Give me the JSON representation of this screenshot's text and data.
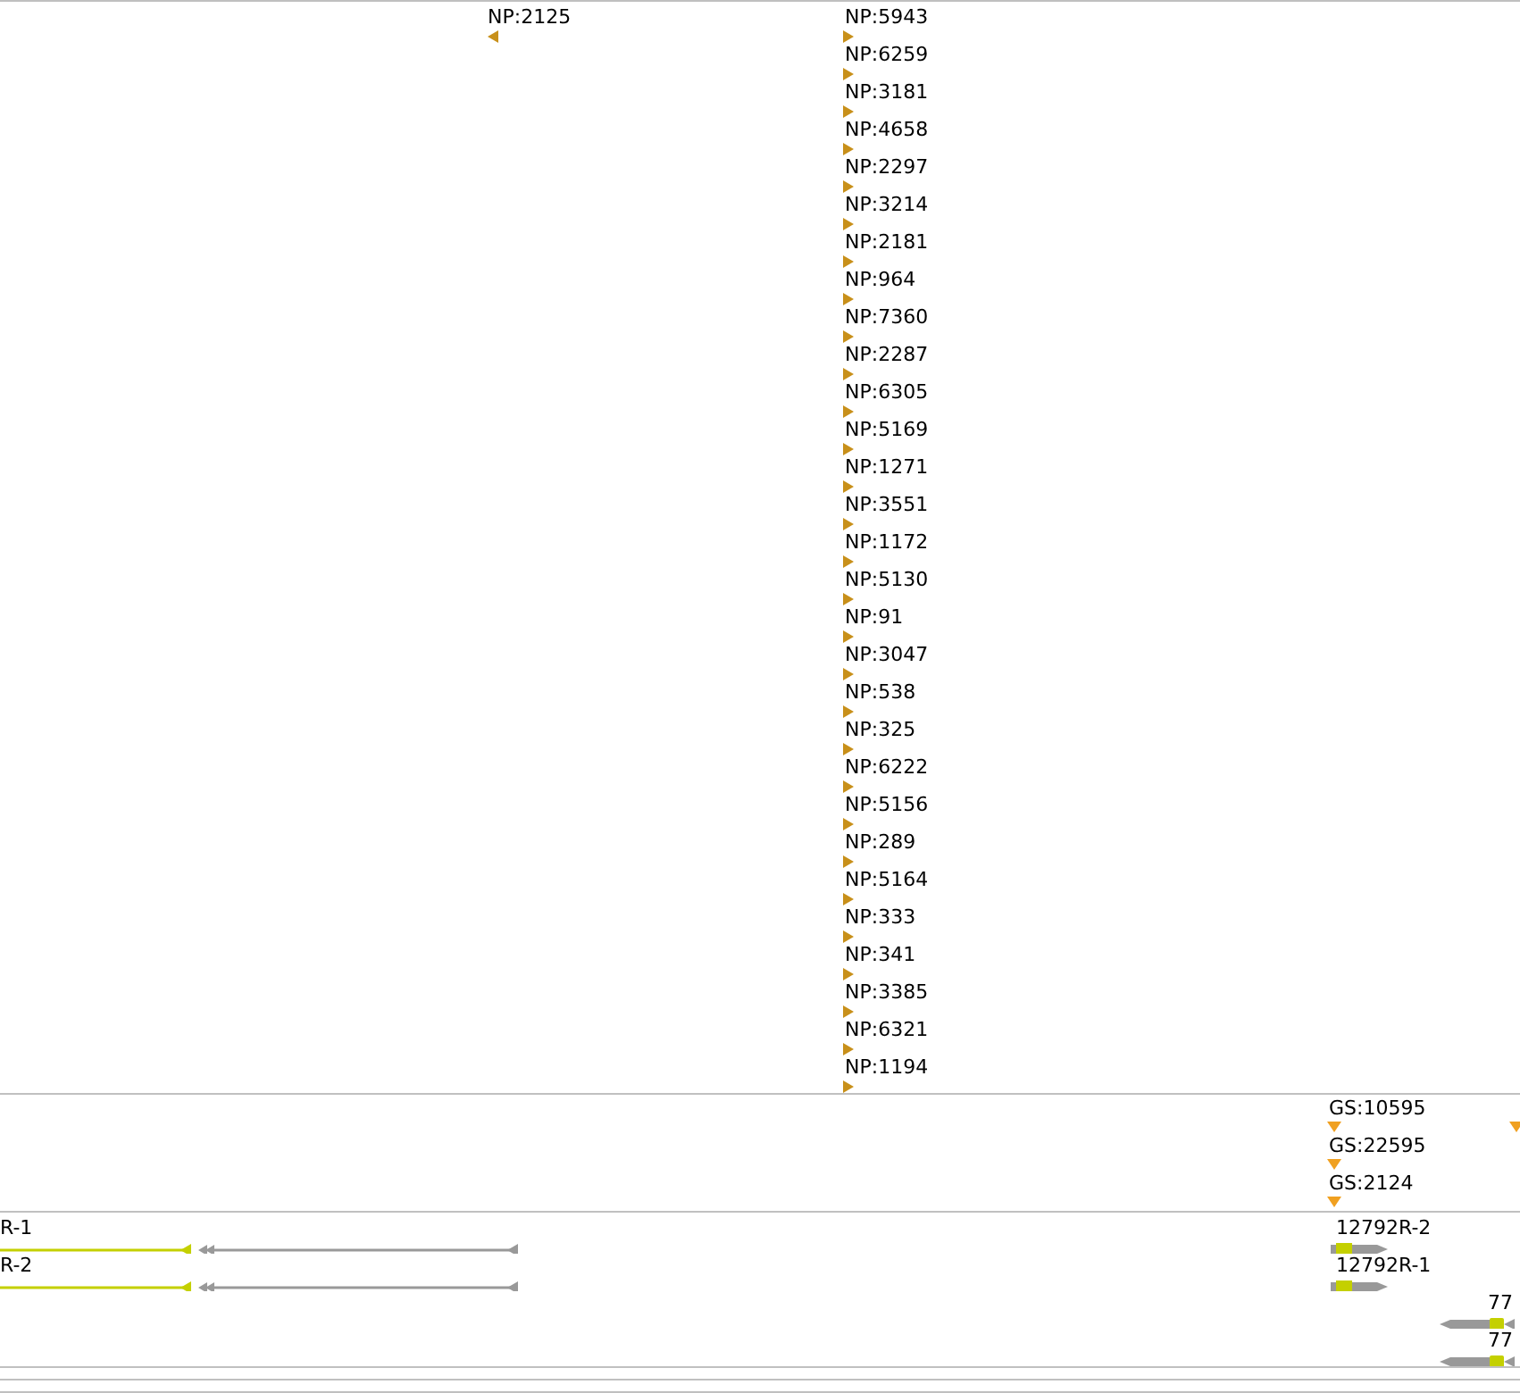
{
  "tracks": [
    {
      "kind": "stranded",
      "stacks": [
        {
          "features": [
            {
              "label": "NP:2125",
              "reverse": true
            }
          ]
        },
        {
          "features": [
            {
              "label": "NP:5943",
              "reverse": false
            },
            {
              "label": "NP:6259",
              "reverse": false
            },
            {
              "label": "NP:3181",
              "reverse": false
            },
            {
              "label": "NP:4658",
              "reverse": false
            },
            {
              "label": "NP:2297",
              "reverse": false
            },
            {
              "label": "NP:3214",
              "reverse": false
            },
            {
              "label": "NP:2181",
              "reverse": false
            },
            {
              "label": "NP:964",
              "reverse": false
            },
            {
              "label": "NP:7360",
              "reverse": false
            },
            {
              "label": "NP:2287",
              "reverse": false
            },
            {
              "label": "NP:6305",
              "reverse": false
            },
            {
              "label": "NP:5169",
              "reverse": false
            },
            {
              "label": "NP:1271",
              "reverse": false
            },
            {
              "label": "NP:3551",
              "reverse": false
            },
            {
              "label": "NP:1172",
              "reverse": false
            },
            {
              "label": "NP:5130",
              "reverse": false
            },
            {
              "label": "NP:91",
              "reverse": false
            },
            {
              "label": "NP:3047",
              "reverse": false
            },
            {
              "label": "NP:538",
              "reverse": false
            },
            {
              "label": "NP:325",
              "reverse": false
            },
            {
              "label": "NP:6222",
              "reverse": false
            },
            {
              "label": "NP:5156",
              "reverse": false
            },
            {
              "label": "NP:289",
              "reverse": false
            },
            {
              "label": "NP:5164",
              "reverse": false
            },
            {
              "label": "NP:333",
              "reverse": false
            },
            {
              "label": "NP:341",
              "reverse": false
            },
            {
              "label": "NP:3385",
              "reverse": false
            },
            {
              "label": "NP:6321",
              "reverse": false
            },
            {
              "label": "NP:1194",
              "reverse": false
            }
          ]
        }
      ]
    },
    {
      "kind": "unstranded",
      "stacks": [
        {
          "kind": "labeled",
          "features": [
            {
              "label": "GS:10595"
            },
            {
              "label": "GS:22595"
            },
            {
              "label": "GS:2124"
            }
          ]
        },
        {
          "kind": "edge"
        }
      ]
    },
    {
      "kind": "genes",
      "stacks": [
        {
          "kind": "long",
          "features": [
            {
              "label": "R-1",
              "reverse": true
            },
            {
              "label": "R-2",
              "reverse": true
            }
          ]
        },
        {
          "kind": "short",
          "features": [
            {
              "label": "12792R-2",
              "reverse": false
            },
            {
              "label": "12792R-1",
              "reverse": false
            }
          ]
        },
        {
          "kind": "short",
          "features": [
            {
              "label": "77",
              "reverse": true
            },
            {
              "label": "77",
              "reverse": true
            }
          ]
        }
      ]
    }
  ]
}
